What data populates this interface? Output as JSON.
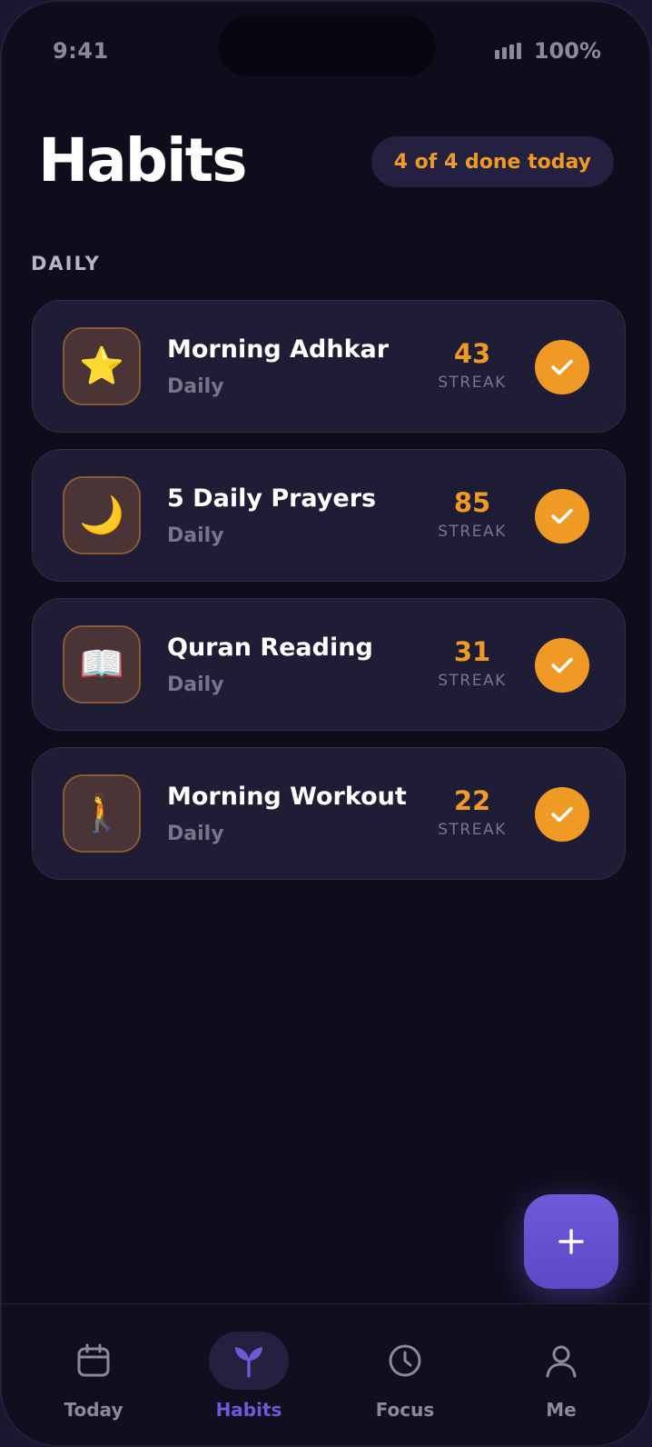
{
  "status_bar": {
    "time": "9:41",
    "battery": "100%"
  },
  "header": {
    "title": "Habits",
    "summary_badge": "4 of 4 done today"
  },
  "section": {
    "label": "DAILY"
  },
  "habits": [
    {
      "icon": "star-icon",
      "emoji": "⭐",
      "name": "Morning Adhkar",
      "frequency": "Daily",
      "streak": "43",
      "streak_label": "STREAK",
      "done": true
    },
    {
      "icon": "crescent-moon-icon",
      "emoji": "🌙",
      "name": "5 Daily Prayers",
      "frequency": "Daily",
      "streak": "85",
      "streak_label": "STREAK",
      "done": true
    },
    {
      "icon": "open-book-icon",
      "emoji": "📖",
      "name": "Quran Reading",
      "frequency": "Daily",
      "streak": "31",
      "streak_label": "STREAK",
      "done": true
    },
    {
      "icon": "person-walking-icon",
      "emoji": "🚶",
      "name": "Morning Workout",
      "frequency": "Daily",
      "streak": "22",
      "streak_label": "STREAK",
      "done": true
    }
  ],
  "fab": {
    "icon": "plus-icon"
  },
  "tabs": [
    {
      "label": "Today",
      "icon": "calendar-icon",
      "active": false
    },
    {
      "label": "Habits",
      "icon": "sprout-icon",
      "active": true
    },
    {
      "label": "Focus",
      "icon": "clock-icon",
      "active": false
    },
    {
      "label": "Me",
      "icon": "person-icon",
      "active": false
    }
  ],
  "colors": {
    "background": "#0e0d1c",
    "card": "#1f1d35",
    "accent_orange": "#f09a26",
    "accent_purple": "#6c5ad9",
    "muted_text": "#77758a"
  }
}
